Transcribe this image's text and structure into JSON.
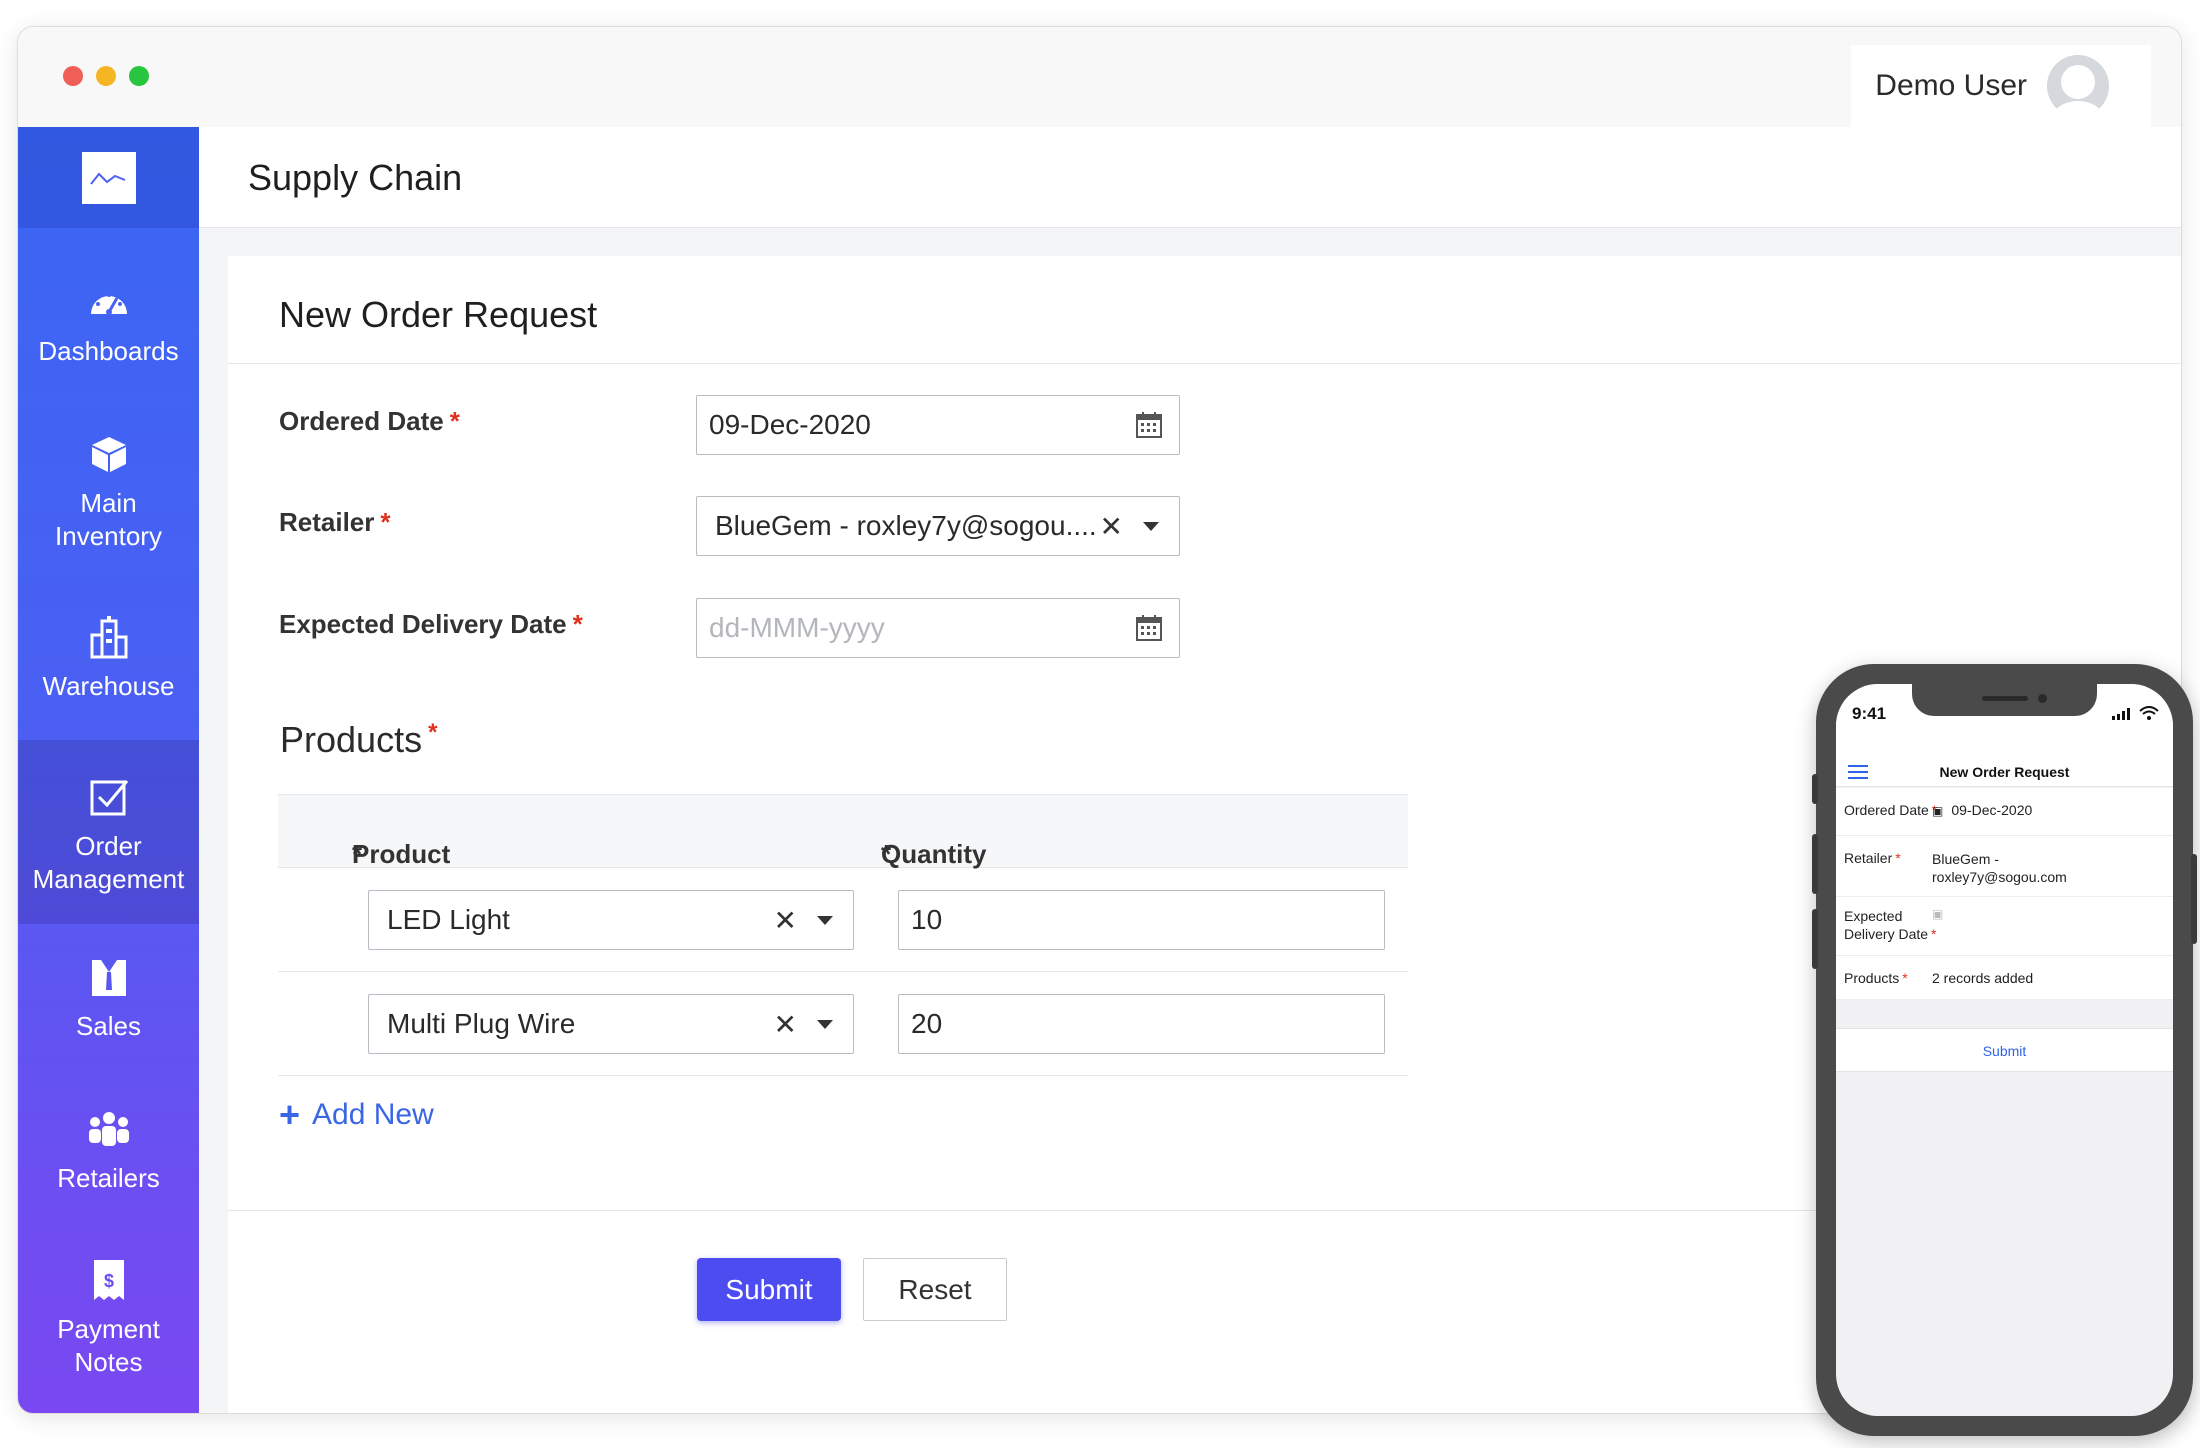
{
  "user": {
    "name": "Demo User"
  },
  "app": {
    "title": "Supply Chain"
  },
  "sidebar": {
    "items": [
      {
        "label": "Dashboards",
        "icon": "speedometer-icon"
      },
      {
        "label": "Main\nInventory",
        "icon": "box-icon"
      },
      {
        "label": "Warehouse",
        "icon": "building-icon"
      },
      {
        "label": "Order\nManagement",
        "icon": "checkbox-icon",
        "active": true
      },
      {
        "label": "Sales",
        "icon": "person-icon"
      },
      {
        "label": "Retailers",
        "icon": "group-icon"
      },
      {
        "label": "Payment\nNotes",
        "icon": "receipt-icon"
      }
    ]
  },
  "form": {
    "title": "New Order Request",
    "ordered_date": {
      "label": "Ordered Date",
      "value": "09-Dec-2020"
    },
    "retailer": {
      "label": "Retailer",
      "value": "BlueGem - roxley7y@sogou...."
    },
    "expected_delivery": {
      "label": "Expected Delivery Date",
      "placeholder": "dd-MMM-yyyy"
    },
    "products": {
      "title": "Products",
      "columns": [
        "Product",
        "Quantity"
      ],
      "rows": [
        {
          "product": "LED Light",
          "quantity": "10"
        },
        {
          "product": "Multi Plug Wire",
          "quantity": "20"
        }
      ],
      "add_label": "Add New"
    },
    "required_mark": "*",
    "submit_label": "Submit",
    "reset_label": "Reset"
  },
  "phone": {
    "time": "9:41",
    "title": "New Order Request",
    "rows": [
      {
        "label": "Ordered Date",
        "value": "09-Dec-2020"
      },
      {
        "label": "Retailer",
        "value": "BlueGem -\nroxley7y@sogou.com"
      },
      {
        "label": "Expected\nDelivery Date",
        "value": ""
      },
      {
        "label": "Products",
        "value": "2 records added"
      }
    ],
    "submit_label": "Submit"
  },
  "colors": {
    "accent": "#4c4cf0",
    "sidebar_top": "#3a66f3",
    "sidebar_bottom": "#7a48f0",
    "required": "#e0301e",
    "link": "#3a66e6"
  }
}
